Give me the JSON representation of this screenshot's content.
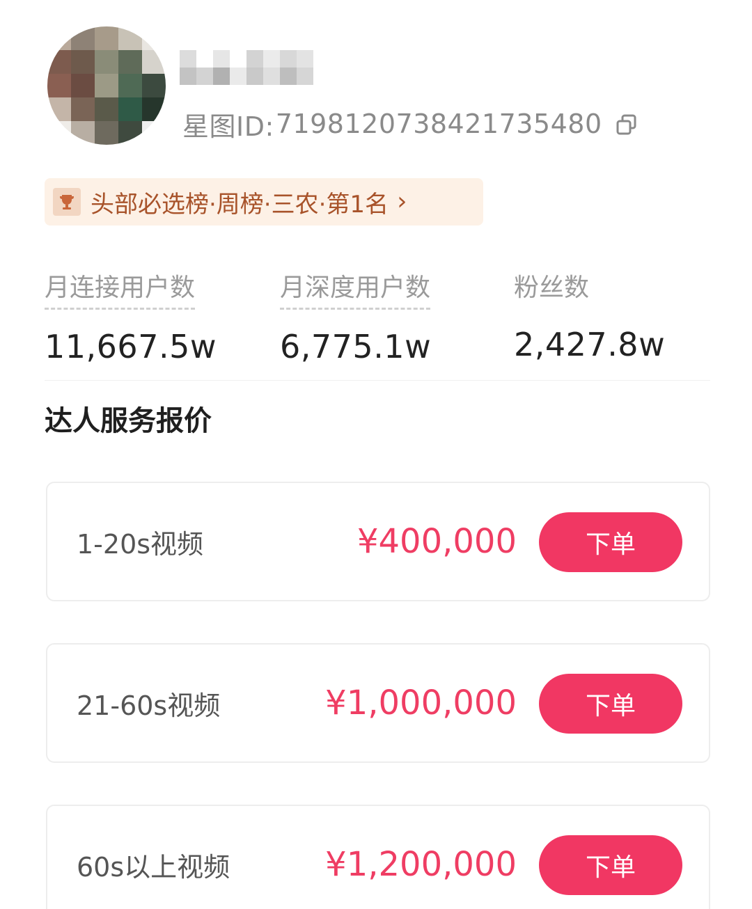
{
  "profile": {
    "id_label": "星图ID:",
    "id_value": "7198120738421735480"
  },
  "rank_badge": {
    "text": "头部必选榜·周榜·三农·第1名",
    "chevron": "›"
  },
  "stats": [
    {
      "label": "月连接用户数",
      "value": "11,667.5w"
    },
    {
      "label": "月深度用户数",
      "value": "6,775.1w"
    },
    {
      "label": "粉丝数",
      "value": "2,427.8w"
    }
  ],
  "pricing": {
    "title": "达人服务报价",
    "items": [
      {
        "label": "1-20s视频",
        "price": "¥400,000",
        "button": "下单"
      },
      {
        "label": "21-60s视频",
        "price": "¥1,000,000",
        "button": "下单"
      },
      {
        "label": "60s以上视频",
        "price": "¥1,200,000",
        "button": "下单"
      }
    ]
  },
  "colors": {
    "accent": "#f13763",
    "price": "#ef3d63",
    "badge_bg": "#fdf1e6",
    "badge_text": "#a8532a"
  },
  "icons": {
    "copy": "copy-icon",
    "trophy": "trophy-icon"
  }
}
